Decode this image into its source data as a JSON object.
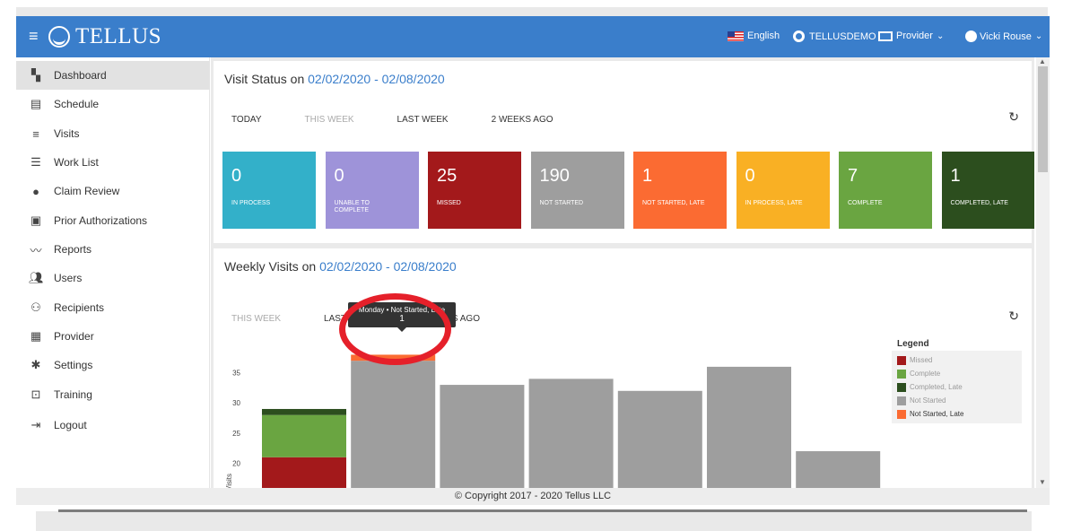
{
  "header": {
    "app_name": "TELLUS",
    "language": "English",
    "agency": "TELLUSDEMO",
    "role": "Provider",
    "user": "Vicki Rouse"
  },
  "sidebar": {
    "items": [
      {
        "label": "Dashboard",
        "icon": "dashboard-icon",
        "active": true
      },
      {
        "label": "Schedule",
        "icon": "calendar-icon"
      },
      {
        "label": "Visits",
        "icon": "filter-icon"
      },
      {
        "label": "Work List",
        "icon": "list-icon"
      },
      {
        "label": "Claim Review",
        "icon": "alert-icon"
      },
      {
        "label": "Prior Authorizations",
        "icon": "calendar-check-icon"
      },
      {
        "label": "Reports",
        "icon": "trend-icon"
      },
      {
        "label": "Users",
        "icon": "users-icon"
      },
      {
        "label": "Recipients",
        "icon": "recipients-icon"
      },
      {
        "label": "Provider",
        "icon": "clipboard-icon"
      },
      {
        "label": "Settings",
        "icon": "gear-icon"
      },
      {
        "label": "Training",
        "icon": "training-icon"
      },
      {
        "label": "Logout",
        "icon": "logout-icon"
      }
    ]
  },
  "visit_status": {
    "title": "Visit Status on",
    "range": "02/02/2020 - 02/08/2020",
    "tabs": [
      "TODAY",
      "THIS WEEK",
      "LAST WEEK",
      "2 WEEKS AGO"
    ],
    "boxes": [
      {
        "value": "0",
        "label": "IN PROCESS",
        "color": "#33b0c9"
      },
      {
        "value": "0",
        "label": "UNABLE TO COMPLETE",
        "color": "#9e93d9"
      },
      {
        "value": "25",
        "label": "MISSED",
        "color": "#a3191b"
      },
      {
        "value": "190",
        "label": "NOT STARTED",
        "color": "#9e9e9e"
      },
      {
        "value": "1",
        "label": "NOT STARTED, LATE",
        "color": "#fb6b32"
      },
      {
        "value": "0",
        "label": "IN PROCESS, LATE",
        "color": "#f9b024"
      },
      {
        "value": "7",
        "label": "COMPLETE",
        "color": "#6aa541"
      },
      {
        "value": "1",
        "label": "COMPLETED, LATE",
        "color": "#2c4e1e"
      }
    ]
  },
  "weekly_visits": {
    "title": "Weekly Visits on",
    "range": "02/02/2020 - 02/08/2020",
    "tabs": [
      "THIS WEEK",
      "LAST WEEK",
      "2 WEEKS AGO"
    ],
    "tooltip_title": "Monday • Not Started, Late",
    "tooltip_value": "1",
    "legend_title": "Legend",
    "legend": [
      {
        "name": "Missed",
        "color": "#a3191b",
        "visible": false
      },
      {
        "name": "Complete",
        "color": "#6aa541",
        "visible": false
      },
      {
        "name": "Completed, Late",
        "color": "#2c4e1e",
        "visible": false
      },
      {
        "name": "Not Started",
        "color": "#9e9e9e",
        "visible": false
      },
      {
        "name": "Not Started, Late",
        "color": "#fb6b32",
        "visible": true
      }
    ]
  },
  "chart_data": {
    "type": "bar",
    "ylabel": "Visits",
    "yticks": [
      15,
      20,
      25,
      30,
      35
    ],
    "ylim": [
      11,
      40
    ],
    "series": [
      {
        "name": "Missed",
        "values": [
          21,
          0,
          0,
          0,
          0,
          0,
          0
        ]
      },
      {
        "name": "Complete",
        "values": [
          7,
          0,
          0,
          0,
          0,
          0,
          0
        ]
      },
      {
        "name": "Completed, Late",
        "values": [
          1,
          0,
          0,
          0,
          0,
          0,
          0
        ]
      },
      {
        "name": "Not Started",
        "values": [
          0,
          37,
          33,
          34,
          32,
          36,
          22
        ]
      },
      {
        "name": "Not Started, Late",
        "values": [
          0,
          1,
          0,
          0,
          0,
          0,
          0
        ]
      }
    ]
  },
  "footer": {
    "text": "© Copyright 2017 - 2020 Tellus LLC"
  }
}
